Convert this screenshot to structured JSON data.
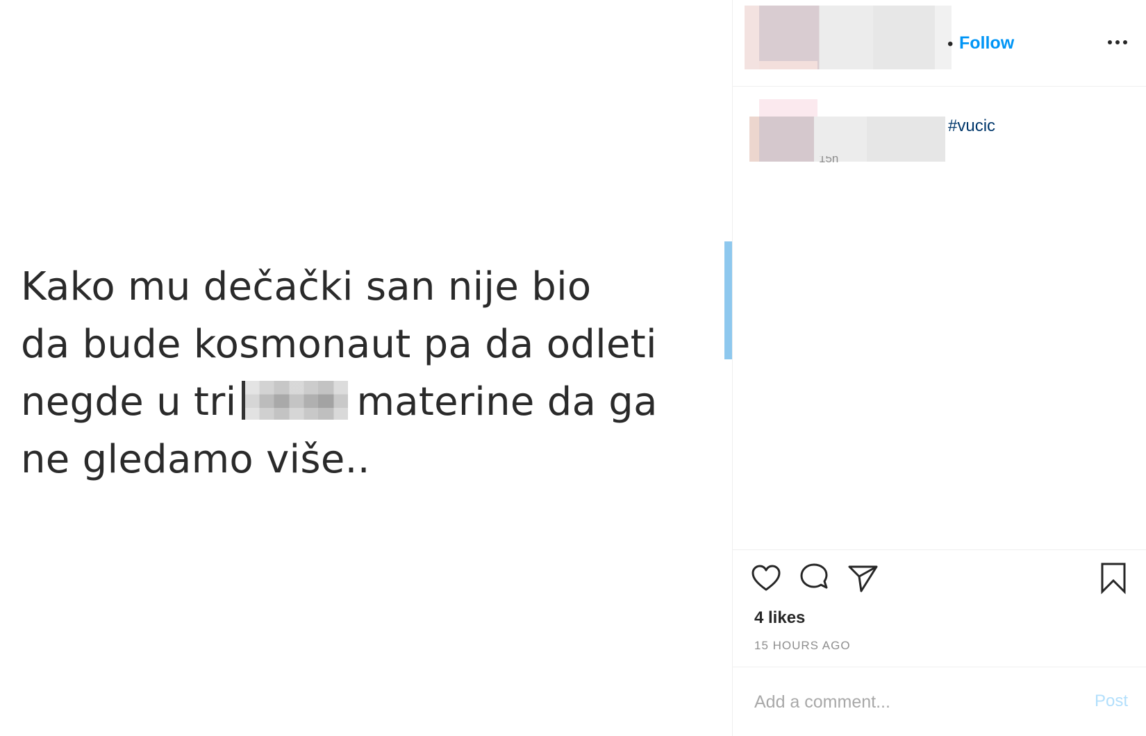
{
  "post_image": {
    "lines": [
      "Kako mu dečački san nije bio",
      "da bude kosmonaut pa da odleti",
      "negde u tri",
      "materine da ga",
      "ne gledamo više.."
    ]
  },
  "header": {
    "follow_separator": "•",
    "follow_label": "Follow"
  },
  "caption": {
    "hashtag": "#vucic",
    "relative_time": "15h"
  },
  "actions": {
    "likes_text": "4 likes",
    "timestamp": "15 HOURS AGO"
  },
  "comment": {
    "placeholder": "Add a comment...",
    "post_label": "Post"
  },
  "colors": {
    "link_blue": "#0095f6",
    "hashtag_blue": "#00376b",
    "post_disabled": "#b2dffc",
    "muted_text": "#8e8e8e"
  },
  "icons": [
    "more-horizontal-icon",
    "heart-icon",
    "comment-bubble-icon",
    "share-paper-plane-icon",
    "bookmark-icon"
  ]
}
